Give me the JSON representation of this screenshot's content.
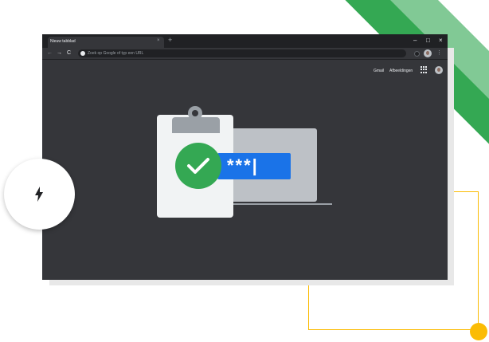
{
  "browser": {
    "tab_title": "Nieuw tabblad",
    "tab_close": "×",
    "new_tab": "+",
    "window_controls": {
      "minimize": "–",
      "maximize": "□",
      "close": "×"
    },
    "nav": {
      "back": "←",
      "forward": "→",
      "reload": "C"
    },
    "omnibox_placeholder": "Zoek op Google of typ een URL",
    "menu": "⋮"
  },
  "ntp": {
    "gmail_link": "Gmail",
    "images_link": "Afbeeldingen"
  },
  "illustration": {
    "password_mask": "***|"
  },
  "colors": {
    "green": "#34a853",
    "light_green": "#81c995",
    "blue": "#1a73e8",
    "yellow": "#fbbc04",
    "window_bg": "#35363a"
  },
  "icons": [
    "google-icon",
    "extension-icon",
    "apps-grid-icon",
    "checkmark-icon",
    "lightning-bolt-icon"
  ]
}
